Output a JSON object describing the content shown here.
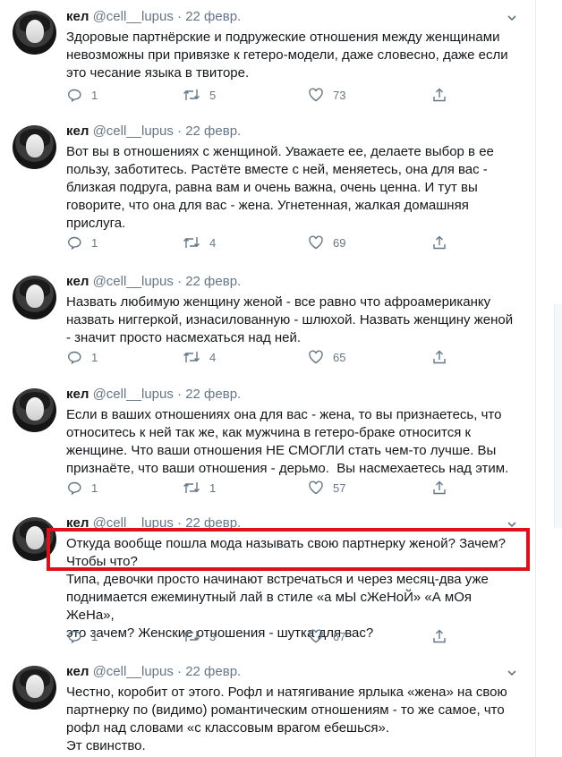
{
  "tweets": [
    {
      "name": "кел",
      "handle": "@cell__lupus",
      "date": "22 февр.",
      "text": "Здоровые партнёрские и подружеские отношения между женщинами\nневозможны при привязке к гетеро-модели, даже словесно, даже если\nэто чесание языка в твиторе.",
      "replies": "1",
      "retweets": "5",
      "likes": "73"
    },
    {
      "name": "кел",
      "handle": "@cell__lupus",
      "date": "22 февр.",
      "text": "Вот вы в отношениях с женщиной. Уважаете ее, делаете выбор в ее\nпользу, заботитесь. Растёте вместе с ней, меняетесь, она для вас -\nблизкая подруга, равна вам и очень важна, очень ценна. И тут вы\nговорите, что она для вас - жена. Угнетенная, жалкая домашняя\nприслуга.",
      "replies": "1",
      "retweets": "4",
      "likes": "69"
    },
    {
      "name": "кел",
      "handle": "@cell__lupus",
      "date": "22 февр.",
      "text": "Назвать любимую женщину женой - все равно что афроамериканку\nназвать ниггеркой, изнасилованную - шлюхой. Назвать женщину женой\n- значит просто насмехаться над ней.",
      "replies": "1",
      "retweets": "4",
      "likes": "65"
    },
    {
      "name": "кел",
      "handle": "@cell__lupus",
      "date": "22 февр.",
      "text": "Если в ваших отношениях она для вас - жена, то вы признаетесь, что\nотноситесь к ней так же, как мужчина в гетеро-браке относится к\nженщине. Что ваши отношения НЕ СМОГЛИ стать чем-то лучше. Вы\nпризнаёте, что ваши отношения - дерьмо.  Вы насмехаетесь над этим.",
      "replies": "1",
      "retweets": "1",
      "likes": "57"
    },
    {
      "name": "кел",
      "handle": "@cell__lupus",
      "date": "22 февр.",
      "text": "Откуда вообще пошла мода называть свою партнерку женой? Зачем?\nЧтобы что?\nТипа, девочки просто начинают встречаться и через месяц-два уже\nподнимается ежеминутный лай в стиле «а мЫ сЖеНоЙ» «А мОя ЖеНа»,\nэто зачем? Женские отношения - шутка для вас?",
      "replies": "1",
      "retweets": "3",
      "likes": "67"
    },
    {
      "name": "кел",
      "handle": "@cell__lupus",
      "date": "22 февр.",
      "text": "Честно, коробит от этого. Рофл и натягивание ярлыка «жена» на свою\nпартнерку по (видимо) романтическим отношениям - то же самое, что\nрофл над словами «с классовым врагом ебешься».\nЭт свинство.",
      "replies": "",
      "retweets": "",
      "likes": ""
    }
  ]
}
